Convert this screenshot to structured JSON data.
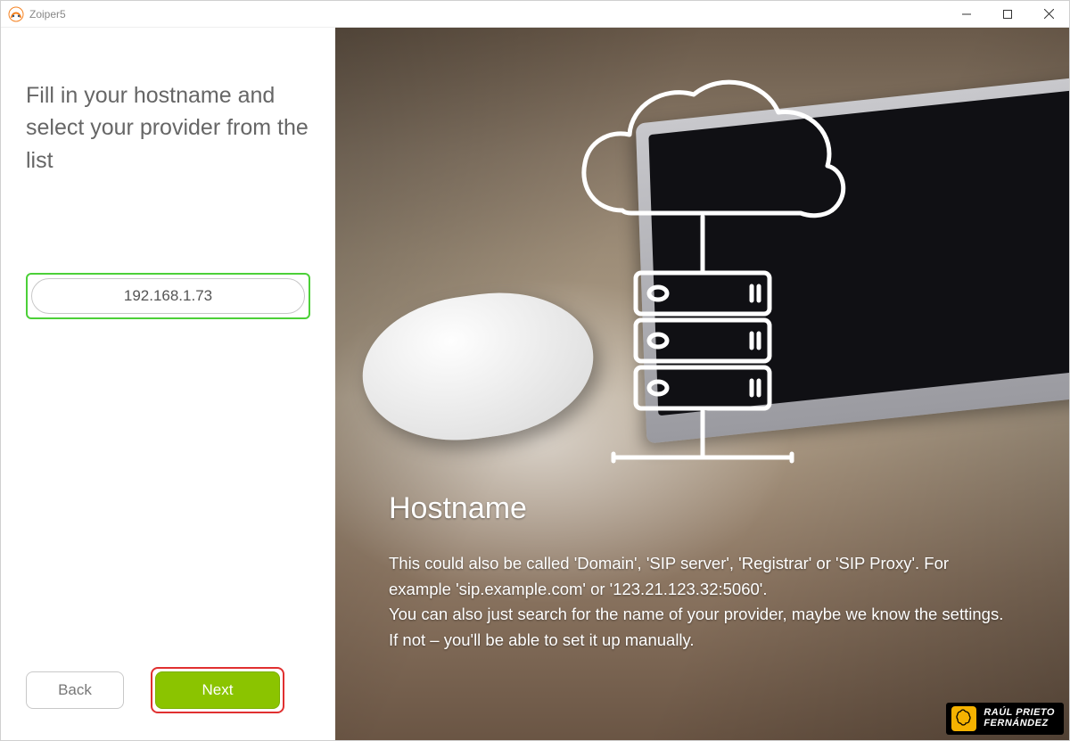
{
  "window": {
    "title": "Zoiper5"
  },
  "left": {
    "heading": "Fill in your hostname and select your provider from the list",
    "hostname_value": "192.168.1.73",
    "back_label": "Back",
    "next_label": "Next"
  },
  "right": {
    "title": "Hostname",
    "paragraph1": " This could also be called 'Domain', 'SIP server', 'Registrar' or 'SIP Proxy'. For example 'sip.example.com' or '123.21.123.32:5060'.",
    "paragraph2": "You can also just search for the name of your provider, maybe we know the settings. If not – you'll be able to set it up manually."
  },
  "watermark": {
    "line1": "RAÚL PRIETO",
    "line2": "FERNÁNDEZ"
  },
  "colors": {
    "accent_green": "#8bc400",
    "highlight_green": "#4cd038",
    "highlight_red": "#e03030"
  }
}
